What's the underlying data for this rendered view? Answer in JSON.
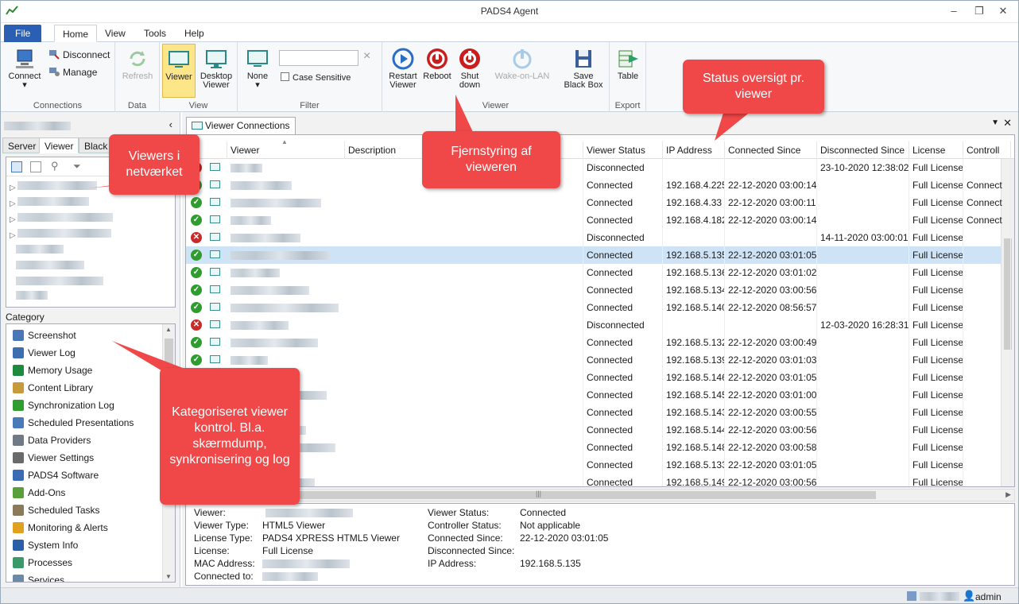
{
  "window": {
    "title": "PADS4 Agent"
  },
  "menu_tabs": [
    "File",
    "Home",
    "View",
    "Tools",
    "Help"
  ],
  "ribbon": {
    "connections": {
      "label": "Connections",
      "connect": "Connect",
      "disconnect": "Disconnect",
      "manage": "Manage"
    },
    "data": {
      "label": "Data",
      "refresh": "Refresh"
    },
    "view": {
      "label": "View",
      "viewer": "Viewer",
      "desktop_viewer_1": "Desktop",
      "desktop_viewer_2": "Viewer"
    },
    "filter": {
      "label": "Filter",
      "none": "None",
      "case_sensitive": "Case Sensitive",
      "clear": "×"
    },
    "viewer": {
      "label": "Viewer",
      "restart_1": "Restart",
      "restart_2": "Viewer",
      "reboot": "Reboot",
      "shutdown_1": "Shut",
      "shutdown_2": "down",
      "wol": "Wake-on-LAN",
      "save_1": "Save",
      "save_2": "Black Box"
    },
    "export": {
      "label": "Export",
      "table": "Table"
    }
  },
  "left": {
    "tabs": [
      "Server",
      "Viewer",
      "Black"
    ],
    "category_title": "Category",
    "categories": [
      "Screenshot",
      "Viewer Log",
      "Memory Usage",
      "Content Library",
      "Synchronization Log",
      "Scheduled Presentations",
      "Data Providers",
      "Viewer Settings",
      "PADS4 Software",
      "Add-Ons",
      "Scheduled Tasks",
      "Monitoring & Alerts",
      "System Info",
      "Processes",
      "Services"
    ],
    "category_colors": [
      "#4a76b8",
      "#3d6fb0",
      "#1e8a3e",
      "#c79a3a",
      "#2e9c2e",
      "#4a7ab8",
      "#707a86",
      "#6a6a6a",
      "#3b6bb5",
      "#5aa03a",
      "#8a7a5a",
      "#e0a020",
      "#2a5fa8",
      "#3a9a6a",
      "#6a8aa8"
    ]
  },
  "main": {
    "doc_tab": "Viewer Connections",
    "columns": [
      "Viewer",
      "Description",
      "Viewer Status",
      "IP Address",
      "Connected Since",
      "Disconnected Since",
      "License",
      "Controll"
    ],
    "rows": [
      {
        "ok": false,
        "status": "Disconnected",
        "ip": "",
        "since": "",
        "dsince": "23-10-2020 12:38:02",
        "lic": "Full License",
        "ctrl": ""
      },
      {
        "ok": true,
        "status": "Connected",
        "ip": "192.168.4.225",
        "since": "22-12-2020 03:00:14",
        "dsince": "",
        "lic": "Full License",
        "ctrl": "Connect"
      },
      {
        "ok": true,
        "status": "Connected",
        "ip": "192.168.4.33",
        "since": "22-12-2020 03:00:11",
        "dsince": "",
        "lic": "Full License",
        "ctrl": "Connect"
      },
      {
        "ok": true,
        "status": "Connected",
        "ip": "192.168.4.182",
        "since": "22-12-2020 03:00:14",
        "dsince": "",
        "lic": "Full License",
        "ctrl": "Connect"
      },
      {
        "ok": false,
        "status": "Disconnected",
        "ip": "",
        "since": "",
        "dsince": "14-11-2020 03:00:01",
        "lic": "Full License",
        "ctrl": ""
      },
      {
        "ok": true,
        "status": "Connected",
        "ip": "192.168.5.135",
        "since": "22-12-2020 03:01:05",
        "dsince": "",
        "lic": "Full License",
        "ctrl": "",
        "sel": true
      },
      {
        "ok": true,
        "status": "Connected",
        "ip": "192.168.5.136",
        "since": "22-12-2020 03:01:02",
        "dsince": "",
        "lic": "Full License",
        "ctrl": ""
      },
      {
        "ok": true,
        "status": "Connected",
        "ip": "192.168.5.134",
        "since": "22-12-2020 03:00:56",
        "dsince": "",
        "lic": "Full License",
        "ctrl": ""
      },
      {
        "ok": true,
        "status": "Connected",
        "ip": "192.168.5.140",
        "since": "22-12-2020 08:56:57",
        "dsince": "",
        "lic": "Full License",
        "ctrl": ""
      },
      {
        "ok": false,
        "status": "Disconnected",
        "ip": "",
        "since": "",
        "dsince": "12-03-2020 16:28:31",
        "lic": "Full License",
        "ctrl": ""
      },
      {
        "ok": true,
        "status": "Connected",
        "ip": "192.168.5.132",
        "since": "22-12-2020 03:00:49",
        "dsince": "",
        "lic": "Full License",
        "ctrl": ""
      },
      {
        "ok": true,
        "status": "Connected",
        "ip": "192.168.5.139",
        "since": "22-12-2020 03:01:03",
        "dsince": "",
        "lic": "Full License",
        "ctrl": ""
      },
      {
        "ok": true,
        "status": "Connected",
        "ip": "192.168.5.146",
        "since": "22-12-2020 03:01:05",
        "dsince": "",
        "lic": "Full License",
        "ctrl": ""
      },
      {
        "ok": true,
        "status": "Connected",
        "ip": "192.168.5.145",
        "since": "22-12-2020 03:01:00",
        "dsince": "",
        "lic": "Full License",
        "ctrl": ""
      },
      {
        "ok": true,
        "status": "Connected",
        "ip": "192.168.5.143",
        "since": "22-12-2020 03:00:55",
        "dsince": "",
        "lic": "Full License",
        "ctrl": ""
      },
      {
        "ok": true,
        "status": "Connected",
        "ip": "192.168.5.144",
        "since": "22-12-2020 03:00:56",
        "dsince": "",
        "lic": "Full License",
        "ctrl": ""
      },
      {
        "ok": true,
        "status": "Connected",
        "ip": "192.168.5.148",
        "since": "22-12-2020 03:00:58",
        "dsince": "",
        "lic": "Full License",
        "ctrl": ""
      },
      {
        "ok": true,
        "status": "Connected",
        "ip": "192.168.5.133",
        "since": "22-12-2020 03:01:05",
        "dsince": "",
        "lic": "Full License",
        "ctrl": ""
      },
      {
        "ok": true,
        "status": "Connected",
        "ip": "192.168.5.149",
        "since": "22-12-2020 03:00:56",
        "dsince": "",
        "lic": "Full License",
        "ctrl": ""
      }
    ]
  },
  "details": {
    "viewer_label": "Viewer:",
    "type_label": "Viewer Type:",
    "type": "HTML5 Viewer",
    "lictype_label": "License Type:",
    "lictype": "PADS4 XPRESS HTML5 Viewer",
    "license_label": "License:",
    "license": "Full License",
    "mac_label": "MAC Address:",
    "connected_to_label": "Connected to:",
    "status_label": "Viewer Status:",
    "status": "Connected",
    "ctrl_label": "Controller Status:",
    "ctrl": "Not applicable",
    "csince_label": "Connected Since:",
    "csince": "22-12-2020 03:01:05",
    "dsince_label": "Disconnected Since:",
    "dsince": "",
    "ip_label": "IP Address:",
    "ip": "192.168.5.135"
  },
  "statusbar": {
    "user": "admin"
  },
  "callouts": {
    "viewers": "Viewers i netværket",
    "remote": "Fjernstyring af vieweren",
    "status": "Status oversigt pr. viewer",
    "category": "Kategoriseret viewer kontrol. Bl.a. skærmdump, synkronisering og log"
  }
}
